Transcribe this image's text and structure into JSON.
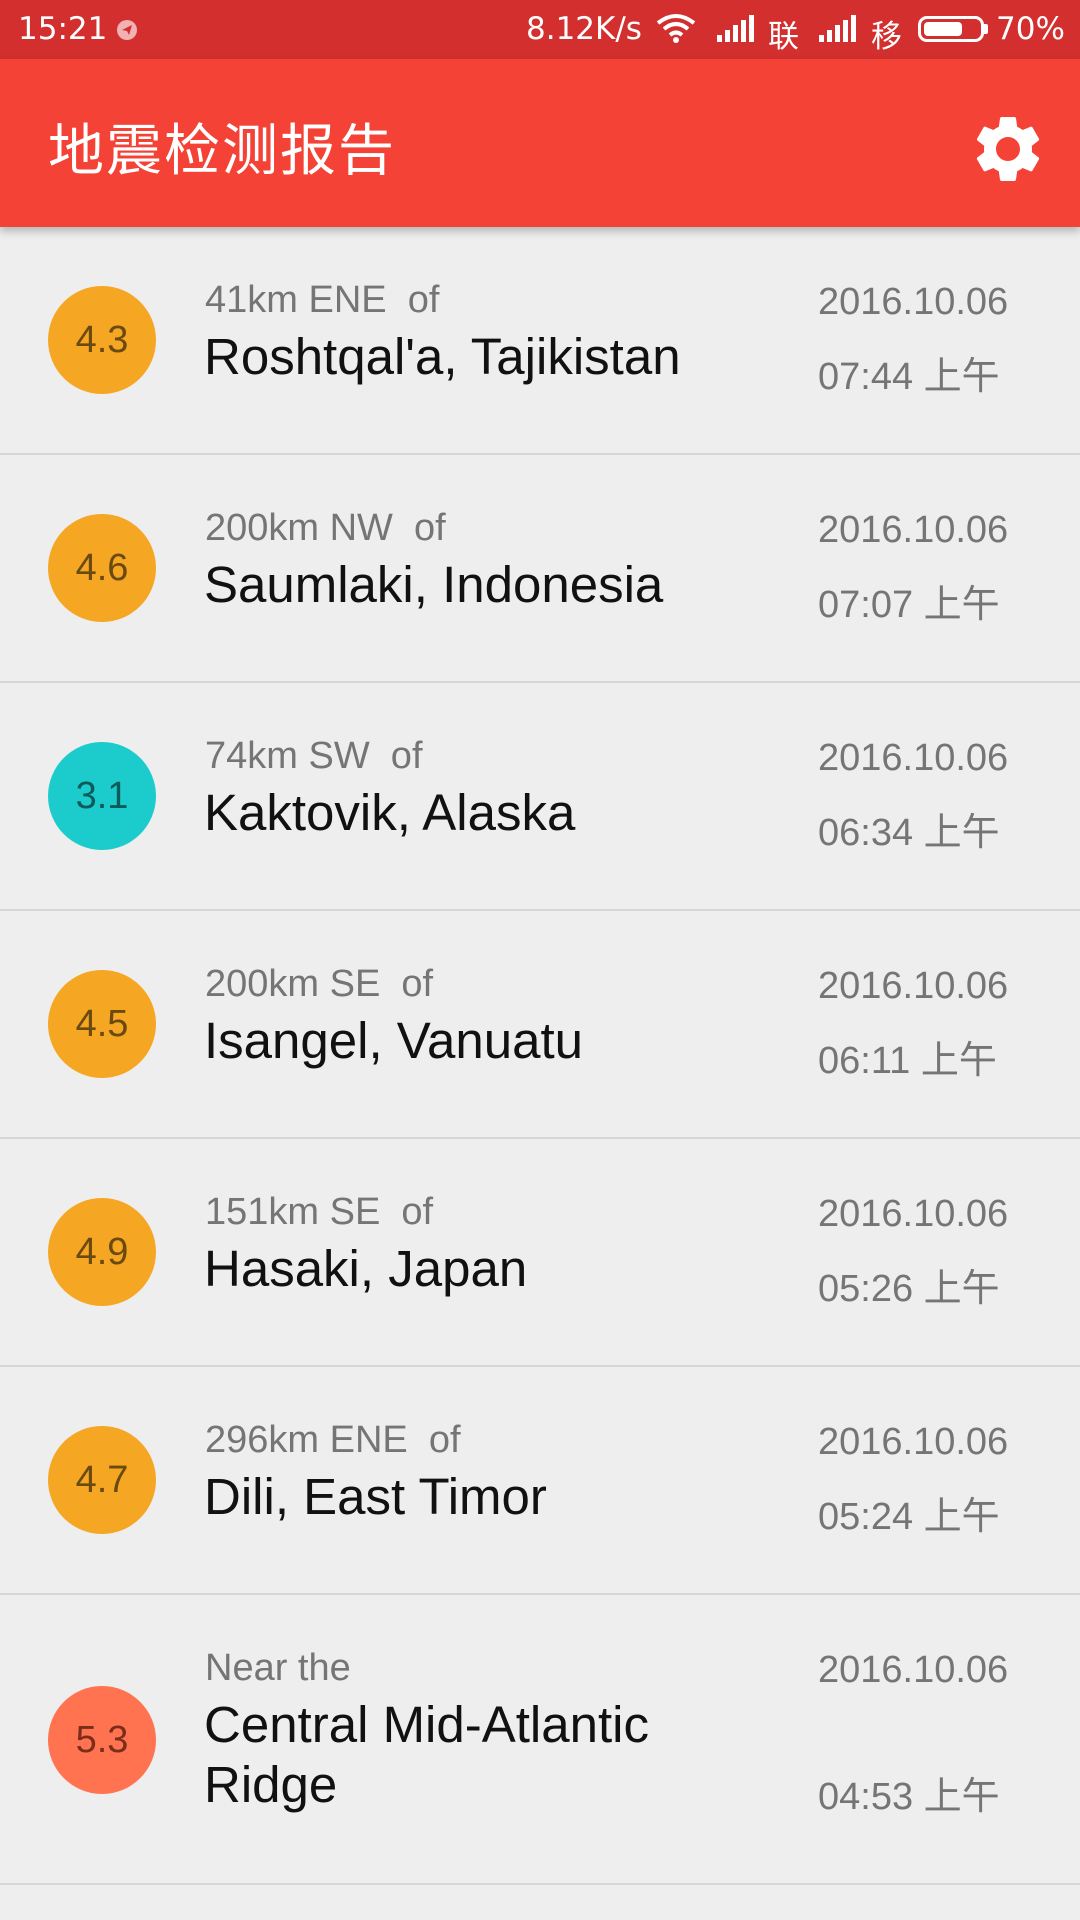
{
  "status_bar": {
    "time": "15:21",
    "net_speed": "8.12K/s",
    "carrier1": "联",
    "carrier2": "移",
    "battery_level": 0.7,
    "battery_text": "70%"
  },
  "app_bar": {
    "title": "地震检测报告",
    "settings_icon": "gear-icon"
  },
  "colors": {
    "status_bar": "#d32f2f",
    "app_bar": "#f44336",
    "mag_orange": "#f5a623",
    "mag_cyan": "#1ccccc",
    "mag_coral": "#ff7350",
    "background": "#eeeeee"
  },
  "earthquakes": [
    {
      "magnitude": "4.3",
      "distance": "41km ENE  of",
      "place": "Roshtqal'a, Tajikistan",
      "date": "2016.10.06",
      "time": "07:44 上午",
      "color": "#f5a623"
    },
    {
      "magnitude": "4.6",
      "distance": "200km NW  of",
      "place": "Saumlaki, Indonesia",
      "date": "2016.10.06",
      "time": "07:07 上午",
      "color": "#f5a623"
    },
    {
      "magnitude": "3.1",
      "distance": "74km SW  of",
      "place": "Kaktovik, Alaska",
      "date": "2016.10.06",
      "time": "06:34 上午",
      "color": "#1ccccc"
    },
    {
      "magnitude": "4.5",
      "distance": "200km SE  of",
      "place": "Isangel, Vanuatu",
      "date": "2016.10.06",
      "time": "06:11 上午",
      "color": "#f5a623"
    },
    {
      "magnitude": "4.9",
      "distance": "151km SE  of",
      "place": "Hasaki, Japan",
      "date": "2016.10.06",
      "time": "05:26 上午",
      "color": "#f5a623"
    },
    {
      "magnitude": "4.7",
      "distance": "296km ENE  of",
      "place": "Dili, East Timor",
      "date": "2016.10.06",
      "time": "05:24 上午",
      "color": "#f5a623"
    },
    {
      "magnitude": "5.3",
      "distance": "Near the",
      "place": "Central Mid-Atlantic Ridge",
      "date": "2016.10.06",
      "time": "04:53 上午",
      "color": "#ff7350"
    }
  ]
}
